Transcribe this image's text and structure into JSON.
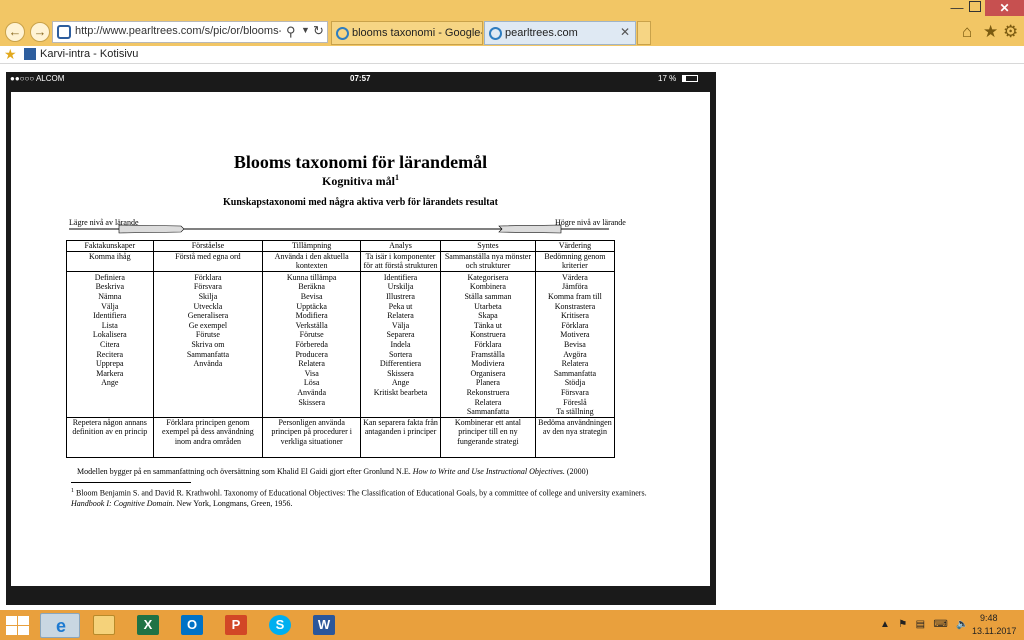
{
  "browser": {
    "url": "http://www.pearltrees.com/s/pic/or/blooms-taxon",
    "tabs": [
      {
        "label": "blooms taxonomi - Google-ha..."
      },
      {
        "label": "pearltrees.com"
      }
    ],
    "favorites": [
      {
        "label": "Karvi-intra - Kotisivu"
      }
    ]
  },
  "phone_status": {
    "carrier": "●●○○○ ALCOM",
    "time": "07:57",
    "battery": "17 %",
    "battery_level": 0.17
  },
  "document": {
    "title": "Blooms taxonomi för lärandemål",
    "subtitle": "Kognitiva mål",
    "subtitle_sup": "1",
    "heading": "Kunskapstaxonomi med några aktiva verb för lärandets resultat",
    "lower_label": "Lägre nivå av lärande",
    "higher_label": "Högre nivå av lärande",
    "table": {
      "headers": [
        "Faktakunskaper",
        "Förståelse",
        "Tillämpning",
        "Analys",
        "Syntes",
        "Värdering"
      ],
      "definitions": [
        "Komma ihåg",
        "Förstå med egna ord",
        "Använda i den aktuella kontexten",
        "Ta isär i komponenter för att förstå strukturen",
        "Sammanställa nya mönster och strukturer",
        "Bedömning genom kriterier"
      ],
      "verbs": [
        "Definiera\nBeskriva\nNämna\nVälja\nIdentifiera\nLista\nLokalisera\nCitera\nRecitera\nUpprepa\nMarkera\nAnge",
        "Förklara\nFörsvara\nSkilja\nUtveckla\nGeneralisera\nGe exempel\nFörutse\nSkriva om\nSammanfatta\nAnvända",
        "Kunna tillämpa\nBeräkna\nBevisa\nUpptäcka\nModifiera\nVerkställa\nFörutse\nFörbereda\nProducera\nRelatera\nVisa\nLösa\nAnvända\nSkissera",
        "Identifiera\nUrskilja\nIllustrera\nPeka ut\nRelatera\nVälja\nSeparera\nIndela\nSortera\nDifferentiera\nSkissera\nAnge\nKritiskt bearbeta",
        "Kategorisera\nKombinera\nStälla samman\nUtarbeta\nSkapa\nTänka ut\nKonstruera\nFörklara\nFramställa\nModiviera\nOrganisera\nPlanera\nRekonstruera\nRelatera\nSammanfatta",
        "Värdera\nJämföra\nKomma fram till\nKonstrastera\nKritisera\nFörklara\nMotivera\nBevisa\nAvgöra\nRelatera\nSammanfatta\nStödja\nFörsvara\nFöreslå\nTa ställning"
      ],
      "examples": [
        "Repetera någon annans definition av en princip",
        "Förklara principen genom exempel på dess användning inom andra områden",
        "Personligen använda principen på procedurer i verkliga situationer",
        "Kan separera fakta från antaganden i principer",
        "Kombinerar ett antal principer till en ny fungerande strategi",
        "Bedöma användningen av den nya strategin"
      ]
    },
    "modell_note_pre": "Modellen bygger på en sammanfattning och översättning som Khalid El Gaidi gjort efter Gronlund N.E.",
    "modell_note_title": "How to Write and Use Instructional Objectives.",
    "modell_note_post": "(2000)",
    "footnote_sup": "1",
    "footnote_pre": "Bloom Benjamin S. and David R. Krathwohl. Taxonomy of Educational Objectives: The Classification of Educational Goals, by a committee of college and university examiners.",
    "footnote_title": "Handbook I: Cognitive Domain.",
    "footnote_post": "New York, Longmans, Green, 1956."
  },
  "taskbar": {
    "apps": [
      {
        "icon": "internet-explorer-icon"
      },
      {
        "icon": "file-explorer-icon"
      },
      {
        "icon": "excel-icon",
        "glyph": "X",
        "color": "#207245"
      },
      {
        "icon": "outlook-icon",
        "glyph": "O",
        "color": "#0072c6"
      },
      {
        "icon": "powerpoint-icon",
        "glyph": "P",
        "color": "#d24726"
      },
      {
        "icon": "skype-icon",
        "glyph": "S",
        "color": "#00aff0"
      },
      {
        "icon": "word-icon",
        "glyph": "W",
        "color": "#2b579a"
      }
    ],
    "time": "9:48",
    "date": "13.11.2017"
  }
}
